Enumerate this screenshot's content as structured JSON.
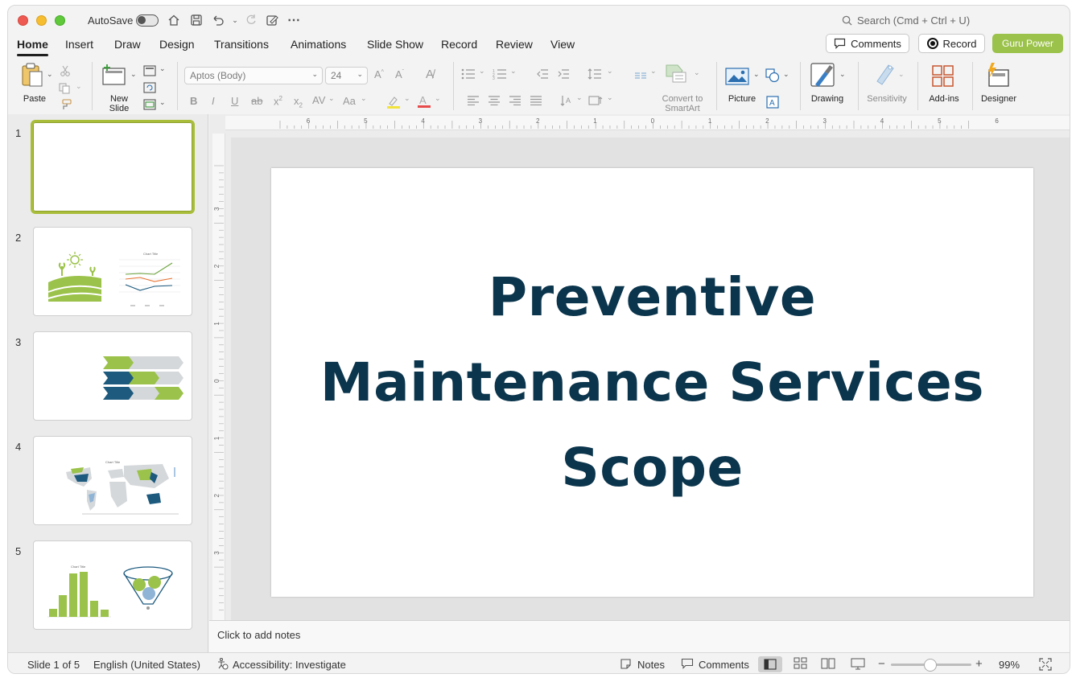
{
  "titlebar": {
    "autosave_label": "AutoSave",
    "search_placeholder": "Search (Cmd + Ctrl + U)"
  },
  "tabs": [
    "Home",
    "Insert",
    "Draw",
    "Design",
    "Transitions",
    "Animations",
    "Slide Show",
    "Record",
    "Review",
    "View"
  ],
  "header_buttons": {
    "comments": "Comments",
    "record": "Record",
    "guru": "Guru Power"
  },
  "ribbon": {
    "paste": "Paste",
    "new_slide": "New Slide",
    "font_name": "Aptos (Body)",
    "font_size": "24",
    "convert_smartart": "Convert to SmartArt",
    "picture": "Picture",
    "drawing": "Drawing",
    "sensitivity": "Sensitivity",
    "addins": "Add-ins",
    "designer": "Designer"
  },
  "ruler": {
    "h_ticks": [
      "6",
      "5",
      "4",
      "3",
      "2",
      "1",
      "0",
      "1",
      "2",
      "3",
      "4",
      "5",
      "6"
    ],
    "v_ticks": [
      "3",
      "2",
      "1",
      "0",
      "1",
      "2",
      "3"
    ]
  },
  "thumbnails": {
    "numbers": [
      "1",
      "2",
      "3",
      "4",
      "5"
    ],
    "chart_title": "Chart Title"
  },
  "slide": {
    "title_line1": "Preventive",
    "title_line2": "Maintenance Services",
    "title_line3": "Scope"
  },
  "notes_placeholder": "Click to add notes",
  "status": {
    "slide_count": "Slide 1 of 5",
    "language": "English (United States)",
    "accessibility": "Accessibility: Investigate",
    "notes": "Notes",
    "comments": "Comments",
    "zoom": "99%"
  },
  "colors": {
    "title_text": "#0b354c",
    "accent_green": "#9bc24a",
    "dark_blue": "#1d5a7e",
    "light_gray": "#d5d8db"
  }
}
